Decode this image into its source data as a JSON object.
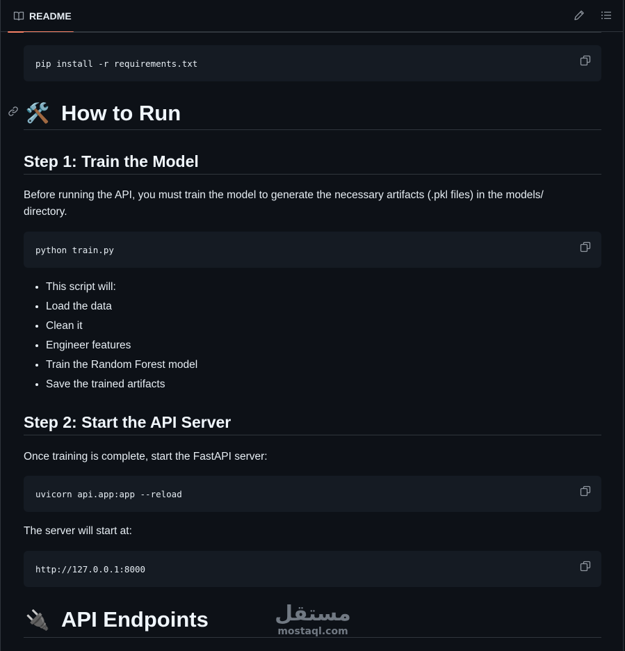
{
  "header": {
    "tab_label": "README",
    "icons": [
      "book-icon",
      "pencil-icon",
      "list-icon"
    ]
  },
  "blocks": {
    "code_install": "pip install -r requirements.txt",
    "how_to_run": {
      "emoji": "🛠️",
      "title": "How to Run"
    },
    "step1": {
      "title": "Step 1: Train the Model",
      "desc_line1": "Before running the API, you must train the model to generate the necessary artifacts (.pkl files) in the models/",
      "desc_line2": "directory.",
      "code": "python train.py",
      "bullets": [
        "This script will:",
        "Load the data",
        "Clean it",
        "Engineer features",
        "Train the Random Forest model",
        "Save the trained artifacts"
      ]
    },
    "step2": {
      "title": "Step 2: Start the API Server",
      "desc": "Once training is complete, start the FastAPI server:",
      "code": "uvicorn api.app:app --reload",
      "server_text": "The server will start at:",
      "server_url": "http://127.0.0.1:8000"
    },
    "api_endpoints": {
      "emoji": "🔌",
      "title": "API Endpoints"
    }
  },
  "watermark": {
    "arabic": "مستقل",
    "latin": "mostaql.com"
  },
  "colors": {
    "background": "#0d1117",
    "code_bg": "#151b23",
    "border": "#30363d",
    "tab_underline": "#f78166",
    "text": "#e6edf3",
    "muted_icon": "#9198a1"
  }
}
